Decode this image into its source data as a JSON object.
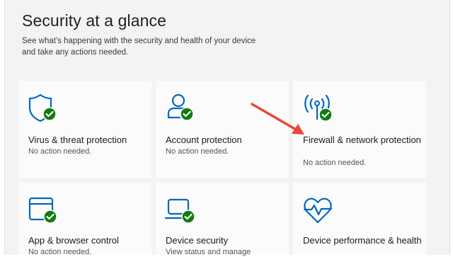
{
  "header": {
    "title": "Security at a glance",
    "subtitle": "See what's happening with the security and health of your device and take any actions needed."
  },
  "cards": [
    {
      "title": "Virus & threat protection",
      "status": "No action needed.",
      "icon": "shield-check-icon"
    },
    {
      "title": "Account protection",
      "status": "No action needed.",
      "icon": "person-check-icon"
    },
    {
      "title": "Firewall & network protection",
      "status": "No action needed.",
      "icon": "antenna-check-icon"
    },
    {
      "title": "App & browser control",
      "status": "No action needed.",
      "icon": "browser-window-check-icon"
    },
    {
      "title": "Device security",
      "status": "View status and manage",
      "icon": "laptop-check-icon"
    },
    {
      "title": "Device performance & health",
      "status": "",
      "icon": "heart-pulse-icon"
    }
  ],
  "colors": {
    "accent": "#0067c0",
    "check": "#107c10",
    "annotation": "#e8483a"
  }
}
